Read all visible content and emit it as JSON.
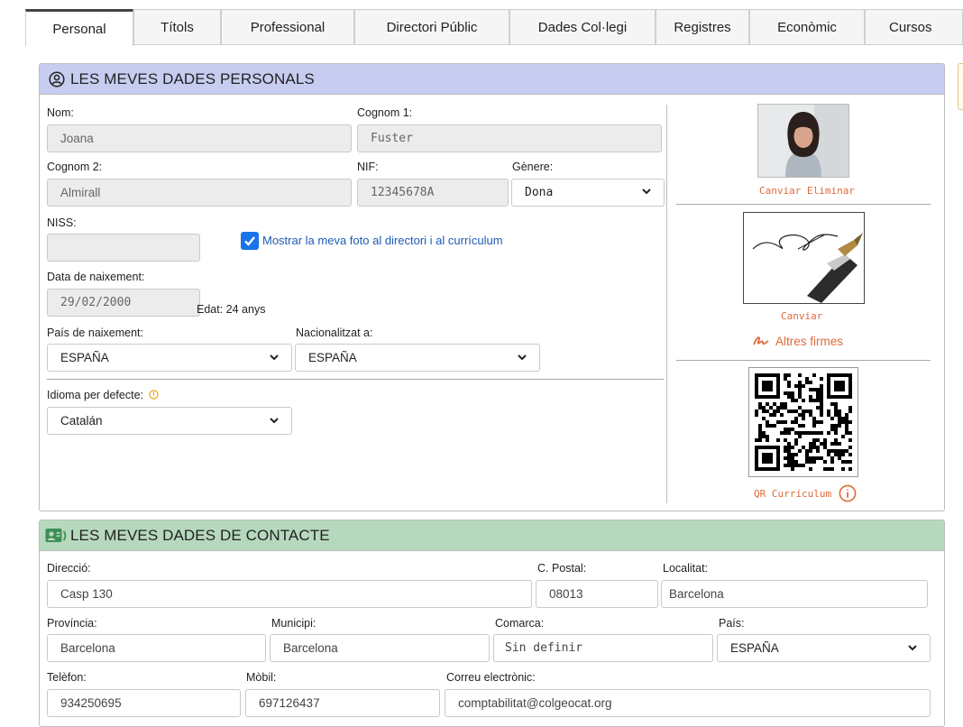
{
  "tabs": [
    "Personal",
    "Títols",
    "Professional",
    "Directori Públic",
    "Dades Col·legi",
    "Registres",
    "Econòmic",
    "Cursos"
  ],
  "personal": {
    "title": "LES MEVES DADES PERSONALS",
    "nom_label": "Nom:",
    "nom_value": "Joana",
    "cognom1_label": "Cognom 1:",
    "cognom1_value": "Fuster",
    "cognom2_label": "Cognom 2:",
    "cognom2_value": "Almirall",
    "nif_label": "NIF:",
    "nif_value": "12345678A",
    "genere_label": "Gènere:",
    "genere_value": "Dona",
    "niss_label": "NISS:",
    "niss_value": "",
    "show_photo_label": "Mostrar la meva foto al directori i al currículum",
    "show_photo_checked": true,
    "birth_label": "Data de naixement:",
    "birth_value": "29/02/2000",
    "age_text": "Edat: 24 anys",
    "birth_country_label": "País de naixement:",
    "birth_country_value": "ESPAÑA",
    "nationality_label": "Nacionalitzat a:",
    "nationality_value": "ESPAÑA",
    "language_label": "Idioma per defecte:",
    "language_value": "Catalán",
    "photo_change": "Canviar",
    "photo_delete": "Eliminar",
    "signature_change": "Canviar",
    "other_signatures": "Altres firmes",
    "qr_label": "QR Currículum"
  },
  "contact": {
    "title": "LES MEVES DADES DE CONTACTE",
    "address_label": "Direcció:",
    "address_value": "Casp 130",
    "postal_label": "C. Postal:",
    "postal_value": "08013",
    "locality_label": "Localitat:",
    "locality_value": "Barcelona",
    "province_label": "Província:",
    "province_value": "Barcelona",
    "municipality_label": "Municipi:",
    "municipality_value": "Barcelona",
    "county_label": "Comarca:",
    "county_value": "Sin definir",
    "country_label": "País:",
    "country_value": "ESPAÑA",
    "phone_label": "Telèfon:",
    "phone_value": "934250695",
    "mobile_label": "Mòbil:",
    "mobile_value": "697126437",
    "email_label": "Correu electrònic:",
    "email_value": "comptabilitat@colgeocat.org"
  },
  "colors": {
    "personal_header": "#c7cdf0",
    "contact_header": "#b6d9bd",
    "accent_orange": "#e06a3a",
    "checkbox_blue": "#1a73e8",
    "contact_icon_green": "#3e8e55"
  }
}
